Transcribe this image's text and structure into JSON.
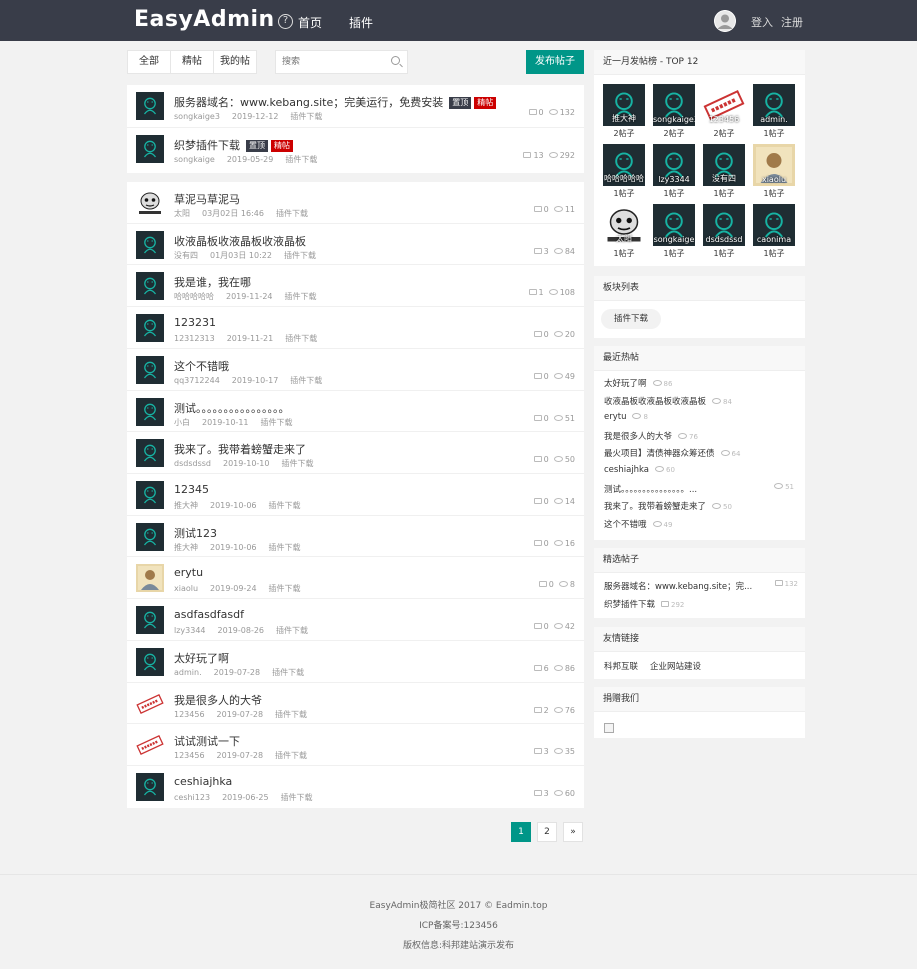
{
  "header": {
    "logo": "EasyAdmin",
    "nav_home": "首页",
    "nav_plugin": "插件",
    "login": "登入",
    "register": "注册"
  },
  "toolbar": {
    "tabs": [
      "全部",
      "精帖",
      "我的帖"
    ],
    "search_placeholder": "搜索",
    "post_button": "发布帖子"
  },
  "badges": {
    "top": "置顶",
    "fine": "精帖"
  },
  "pinned": [
    {
      "title": "服务器域名：www.kebang.site；完美运行，免费安装",
      "author": "songkaige3",
      "date": "2019-12-12",
      "category": "插件下载",
      "comments": "0",
      "views": "132",
      "top": true,
      "fine": true
    },
    {
      "title": "织梦插件下载",
      "author": "songkaige",
      "date": "2019-05-29",
      "category": "插件下载",
      "comments": "13",
      "views": "292",
      "top": true,
      "fine": true
    }
  ],
  "posts": [
    {
      "title": "草泥马草泥马",
      "author": "太阳",
      "date": "03月02日 16:46",
      "category": "插件下载",
      "comments": "0",
      "views": "11",
      "avatar": "meme"
    },
    {
      "title": "收液晶板收液晶板收液晶板",
      "author": "没有四",
      "date": "01月03日 10:22",
      "category": "插件下载",
      "comments": "3",
      "views": "84",
      "avatar": "default"
    },
    {
      "title": "我是谁，我在哪",
      "author": "哈哈哈哈哈",
      "date": "2019-11-24",
      "category": "插件下载",
      "comments": "1",
      "views": "108",
      "avatar": "default"
    },
    {
      "title": "123231",
      "author": "12312313",
      "date": "2019-11-21",
      "category": "插件下载",
      "comments": "0",
      "views": "20",
      "avatar": "default"
    },
    {
      "title": "这个不错哦",
      "author": "qq3712244",
      "date": "2019-10-17",
      "category": "插件下载",
      "comments": "0",
      "views": "49",
      "avatar": "default"
    },
    {
      "title": "测试。。。。。。。。。。。。。。。。",
      "author": "小白",
      "date": "2019-10-11",
      "category": "插件下载",
      "comments": "0",
      "views": "51",
      "avatar": "default"
    },
    {
      "title": "我来了。我带着螃蟹走来了",
      "author": "dsdsdssd",
      "date": "2019-10-10",
      "category": "插件下载",
      "comments": "0",
      "views": "50",
      "avatar": "default"
    },
    {
      "title": "12345",
      "author": "推大神",
      "date": "2019-10-06",
      "category": "插件下载",
      "comments": "0",
      "views": "14",
      "avatar": "default"
    },
    {
      "title": "测试123",
      "author": "推大神",
      "date": "2019-10-06",
      "category": "插件下载",
      "comments": "0",
      "views": "16",
      "avatar": "default"
    },
    {
      "title": "erytu",
      "author": "xiaolu",
      "date": "2019-09-24",
      "category": "插件下载",
      "comments": "0",
      "views": "8",
      "avatar": "photo"
    },
    {
      "title": "asdfasdfasdf",
      "author": "lzy3344",
      "date": "2019-08-26",
      "category": "插件下载",
      "comments": "0",
      "views": "42",
      "avatar": "default"
    },
    {
      "title": "太好玩了啊",
      "author": "admin.",
      "date": "2019-07-28",
      "category": "插件下载",
      "comments": "6",
      "views": "86",
      "avatar": "default"
    },
    {
      "title": "我是很多人的大爷",
      "author": "123456",
      "date": "2019-07-28",
      "category": "插件下载",
      "comments": "2",
      "views": "76",
      "avatar": "stamp"
    },
    {
      "title": "试试测试一下",
      "author": "123456",
      "date": "2019-07-28",
      "category": "插件下载",
      "comments": "3",
      "views": "35",
      "avatar": "stamp"
    },
    {
      "title": "ceshiajhka",
      "author": "ceshi123",
      "date": "2019-06-25",
      "category": "插件下载",
      "comments": "3",
      "views": "60",
      "avatar": "default"
    }
  ],
  "pagination": {
    "pages": [
      "1",
      "2",
      "»"
    ]
  },
  "top_posters": {
    "title": "近一月发帖榜 - TOP 12",
    "users": [
      {
        "name": "推大神",
        "count": "2帖子",
        "avatar": "default"
      },
      {
        "name": "songkaige3",
        "count": "2帖子",
        "avatar": "default"
      },
      {
        "name": "123456",
        "count": "2帖子",
        "avatar": "stamp"
      },
      {
        "name": "admin.",
        "count": "1帖子",
        "avatar": "default"
      },
      {
        "name": "哈哈哈哈哈",
        "count": "1帖子",
        "avatar": "default"
      },
      {
        "name": "lzy3344",
        "count": "1帖子",
        "avatar": "default"
      },
      {
        "name": "没有四",
        "count": "1帖子",
        "avatar": "default"
      },
      {
        "name": "xiaolu",
        "count": "1帖子",
        "avatar": "photo"
      },
      {
        "name": "太阳",
        "count": "1帖子",
        "avatar": "meme"
      },
      {
        "name": "songkaige",
        "count": "1帖子",
        "avatar": "default"
      },
      {
        "name": "dsdsdssd",
        "count": "1帖子",
        "avatar": "default"
      },
      {
        "name": "caonima",
        "count": "1帖子",
        "avatar": "default"
      }
    ]
  },
  "boards": {
    "title": "板块列表",
    "items": [
      "插件下载"
    ]
  },
  "hot_posts": {
    "title": "最近热帖",
    "items": [
      {
        "title": "太好玩了啊",
        "views": "86"
      },
      {
        "title": "收液晶板收液晶板收液晶板",
        "views": "84"
      },
      {
        "title": "erytu",
        "views": "8"
      },
      {
        "title": "我是很多人的大爷",
        "views": "76"
      },
      {
        "title": "最火项目】清债神器众筹还债",
        "views": "64"
      },
      {
        "title": "ceshiajhka",
        "views": "60"
      },
      {
        "title": "测试。。。。。。。。。。。。。。。...",
        "views": "51"
      },
      {
        "title": "我来了。我带着螃蟹走来了",
        "views": "50"
      },
      {
        "title": "这个不错哦",
        "views": "49"
      }
    ]
  },
  "featured": {
    "title": "精选帖子",
    "items": [
      {
        "title": "服务器域名：www.kebang.site；完...",
        "views": "132"
      },
      {
        "title": "织梦插件下载",
        "views": "292"
      }
    ]
  },
  "links": {
    "title": "友情链接",
    "items": [
      "科邦互联",
      "企业网站建设"
    ]
  },
  "donate": {
    "title": "捐赠我们"
  },
  "footer": {
    "line1": "EasyAdmin极简社区  2017 ©  Eadmin.top",
    "line2": "ICP备案号:123456",
    "line3": "版权信息:科邦建站演示发布"
  },
  "avatar_label": {
    "stamp": "清图专用",
    "meme": "我是个表情"
  },
  "colors": {
    "header": "#393d49",
    "accent": "#009688",
    "badge_top": "#393d49",
    "badge_fine": "#cc0000",
    "avatar_bg": "#1f2d33",
    "avatar_line": "#17b3a3"
  }
}
